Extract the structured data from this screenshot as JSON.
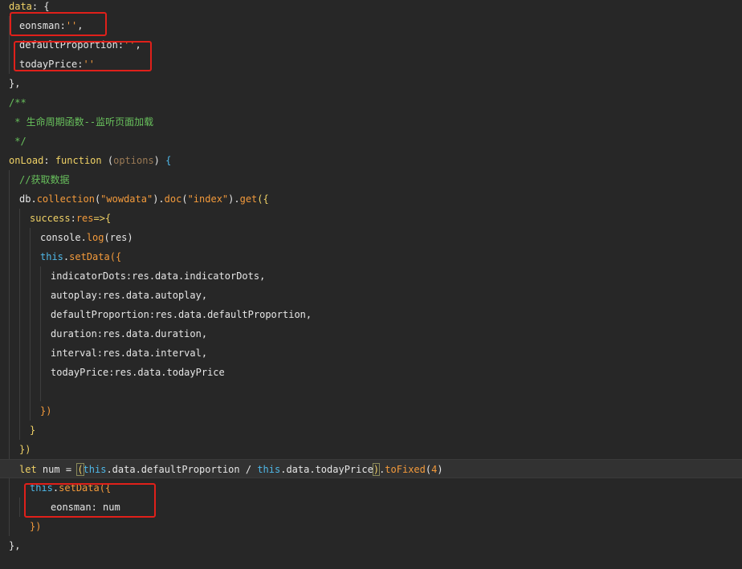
{
  "code_lines": [
    "data: {",
    "  eonsman:'',",
    "  defaultProportion:'',",
    "  todayPrice:''",
    "},",
    "/**",
    " * 生命周期函数--监听页面加载",
    " */",
    "onLoad: function (options) {",
    "  //获取数据",
    "  db.collection(\"wowdata\").doc(\"index\").get({",
    "    success:res=>{",
    "      console.log(res)",
    "      this.setData({",
    "        indicatorDots:res.data.indicatorDots,",
    "        autoplay:res.data.autoplay,",
    "        defaultProportion:res.data.defaultProportion,",
    "        duration:res.data.duration,",
    "        interval:res.data.interval,",
    "        todayPrice:res.data.todayPrice",
    "",
    "",
    "      })",
    "    }",
    "  })",
    "  let num = (this.data.defaultProportion / this.data.todayPrice).toFixed(4)",
    "    this.setData({",
    "      eonsman: num",
    "    })",
    "},"
  ],
  "tokens": {
    "data_key": "data",
    "colon": ":",
    "open_brace": " {",
    "eonsman_key": "eonsman",
    "empty_str": "''",
    "comma": ",",
    "default_prop_key": "defaultProportion",
    "today_price_key": "todayPrice",
    "close_brace_comma": "},",
    "doc_open": "/**",
    "doc_text": " * 生命周期函数--监听页面加载",
    "doc_close": " */",
    "onload_key": "onLoad",
    "function_kw": "function",
    "options_param": "options",
    "comment_fetch": "//获取数据",
    "db": "db",
    "collection_fn": "collection",
    "wowdata_str": "\"wowdata\"",
    "doc_fn": "doc",
    "index_str": "\"index\"",
    "get_fn": "get",
    "success_key": "success",
    "res": "res",
    "arrow": "=>",
    "console": "console",
    "log_fn": "log",
    "this_kw": "this",
    "setdata_fn": "setData",
    "indicator_dots": "indicatorDots",
    "autoplay": "autoplay",
    "duration": "duration",
    "interval": "interval",
    "res_data_indicator": "res.data.indicatorDots",
    "res_data_autoplay": "res.data.autoplay",
    "res_data_default": "res.data.defaultProportion",
    "res_data_duration": "res.data.duration",
    "res_data_interval": "res.data.interval",
    "res_data_today": "res.data.todayPrice",
    "let_kw": "let",
    "num_var": "num",
    "data_default": ".data.defaultProportion",
    "data_today": ".data.todayPrice",
    "tofixed_fn": "toFixed",
    "four": "4",
    "eonsman_num": "eonsman: num"
  },
  "colors": {
    "background": "#272727",
    "current_line": "#323232",
    "highlight_box": "#e0201a",
    "string": "#f39a3b",
    "keyword": "#f0d266",
    "comment": "#68c05c",
    "this_keyword": "#4fb8e8"
  }
}
